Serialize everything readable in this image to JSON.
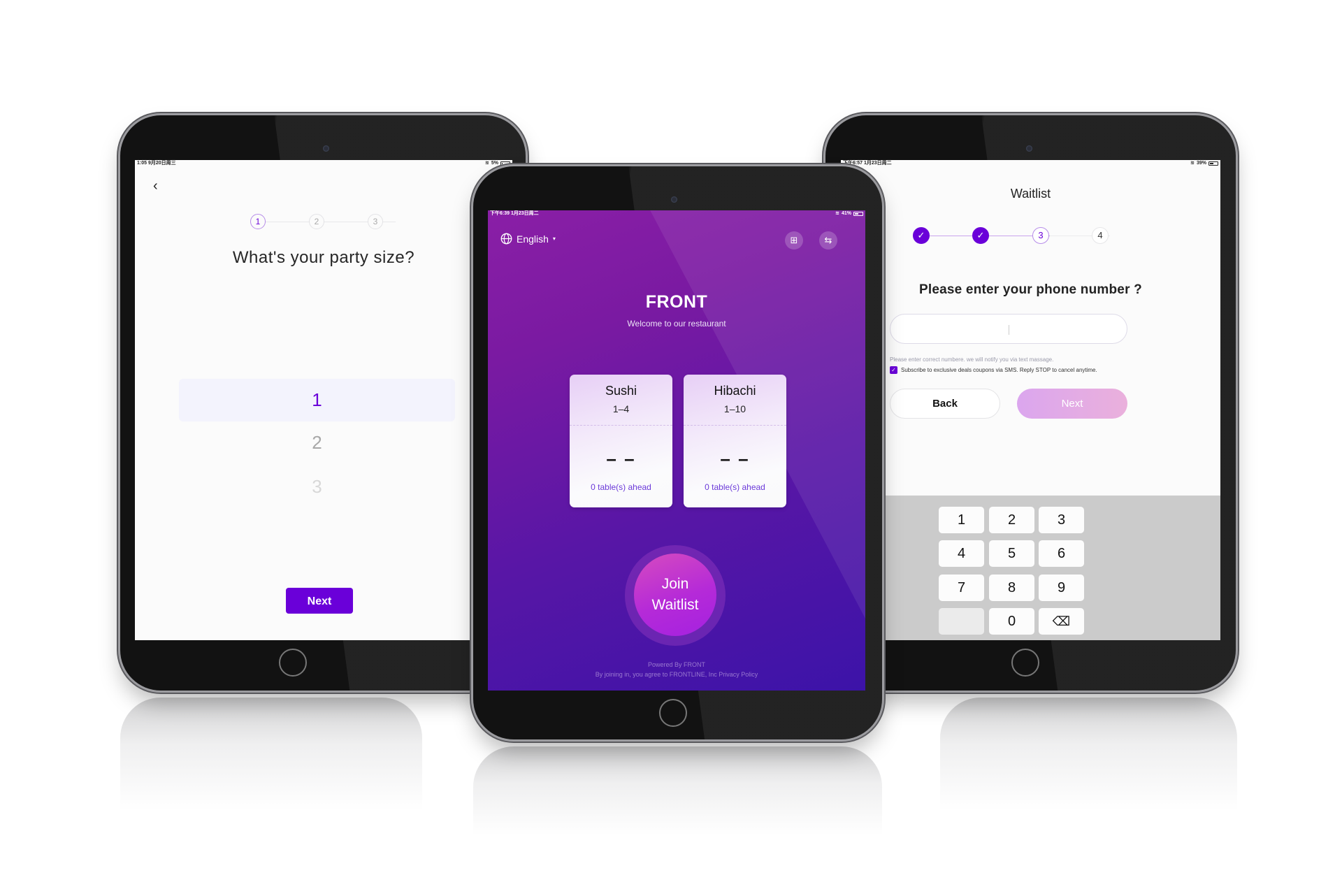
{
  "party_size_screen": {
    "status_bar": {
      "time": "1:05  9月20日周三",
      "battery": "5%"
    },
    "back_icon": "chevron-left",
    "steps": [
      "1",
      "2",
      "3"
    ],
    "active_step": 1,
    "title": "What's your party size?",
    "options": [
      "1",
      "2",
      "3"
    ],
    "selected_option": "1",
    "next_label": "Next"
  },
  "welcome_screen": {
    "status_bar": {
      "time": "下午6:39  1月23日周二",
      "battery": "41%"
    },
    "language": "English",
    "icons": [
      "globe-icon",
      "qr-code-icon",
      "exit-icon"
    ],
    "brand": "FRONT",
    "welcome": "Welcome to our restaurant",
    "queues": [
      {
        "name": "Sushi",
        "range": "1–4",
        "wait": "– –",
        "ahead": "0 table(s) ahead"
      },
      {
        "name": "Hibachi",
        "range": "1–10",
        "wait": "– –",
        "ahead": "0 table(s) ahead"
      }
    ],
    "join_label": "Join\nWaitlist",
    "powered_by": "Powered By FRONT",
    "agreement": "By joining in, you agree to FRONTLINE, Inc Privacy Policy"
  },
  "phone_screen": {
    "status_bar": {
      "time": "下午6:57  1月23日周二",
      "battery": "39%"
    },
    "title": "Waitlist",
    "steps": [
      "✓",
      "✓",
      "3",
      "4"
    ],
    "current_step": 3,
    "question": "Please enter your phone number ?",
    "phone_value": "",
    "hint": "Please enter correct numbere. we will notify you via text massage.",
    "subscribe_label": "Subscribe to exclusive deals coupons via SMS. Reply STOP to cancel anytime.",
    "subscribe_checked": true,
    "back_label": "Back",
    "next_label": "Next",
    "keypad": [
      "1",
      "2",
      "3",
      "4",
      "5",
      "6",
      "7",
      "8",
      "9",
      "",
      "0",
      "⌫"
    ]
  },
  "colors": {
    "accent": "#6a00d9",
    "card_text": "#6b3ad9",
    "keyboard_bg": "#cbcbcb"
  }
}
